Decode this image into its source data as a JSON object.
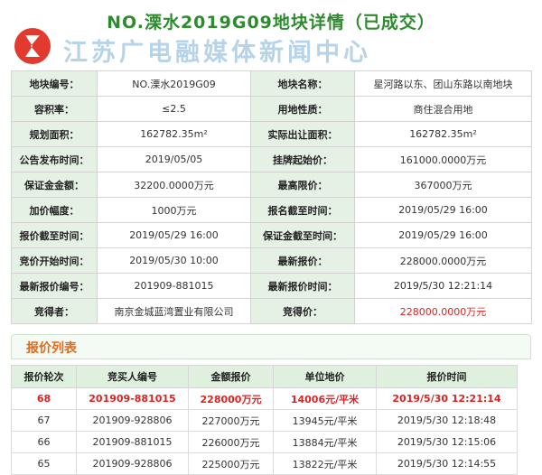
{
  "header": {
    "title": "NO.溧水2019G09地块详情（已成交）",
    "watermark": "江苏广电融媒体新闻中心"
  },
  "details": [
    [
      {
        "label": "地块编号：",
        "value": "NO.溧水2019G09"
      },
      {
        "label": "地块名称：",
        "value": "星河路以东、团山东路以南地块"
      }
    ],
    [
      {
        "label": "容积率：",
        "value": "≤2.5"
      },
      {
        "label": "用地性质：",
        "value": "商住混合用地"
      }
    ],
    [
      {
        "label": "规划面积：",
        "value": "162782.35m²"
      },
      {
        "label": "实际出让面积：",
        "value": "162782.35m²"
      }
    ],
    [
      {
        "label": "公告发布时间：",
        "value": "2019/05/05"
      },
      {
        "label": "挂牌起始价：",
        "value": "161000.0000万元"
      }
    ],
    [
      {
        "label": "保证金金额：",
        "value": "32200.0000万元"
      },
      {
        "label": "最高限价：",
        "value": "367000万元"
      }
    ],
    [
      {
        "label": "加价幅度：",
        "value": "1000万元"
      },
      {
        "label": "报名截至时间：",
        "value": "2019/05/29 16:00"
      }
    ],
    [
      {
        "label": "报价截至时间：",
        "value": "2019/05/29 16:00"
      },
      {
        "label": "保证金截至时间：",
        "value": "2019/05/29 16:00"
      }
    ],
    [
      {
        "label": "竞价开始时间：",
        "value": "2019/05/30 10:00"
      },
      {
        "label": "最新报价：",
        "value": "228000.0000万元"
      }
    ],
    [
      {
        "label": "最新报价编号：",
        "value": "201909-881015"
      },
      {
        "label": "最新报价时间：",
        "value": "2019/5/30 12:21:14"
      }
    ],
    [
      {
        "label": "竞得者：",
        "value": "南京金城蓝湾置业有限公司"
      },
      {
        "label": "竞得价：",
        "value": "228000.0000万元",
        "red": true
      }
    ]
  ],
  "quotes": {
    "title": "报价列表",
    "columns": [
      "报价轮次",
      "竞买人编号",
      "金额报价",
      "单位地价",
      "报价时间"
    ],
    "rows": [
      [
        "68",
        "201909-881015",
        "228000万元",
        "14006元/平米",
        "2019/5/30 12:21:14"
      ],
      [
        "67",
        "201909-928806",
        "227000万元",
        "13945元/平米",
        "2019/5/30 12:18:48"
      ],
      [
        "66",
        "201909-881015",
        "226000万元",
        "13884元/平米",
        "2019/5/30 12:15:06"
      ],
      [
        "65",
        "201909-928806",
        "225000万元",
        "13822元/平米",
        "2019/5/30 12:14:55"
      ]
    ]
  },
  "colors": {
    "title": "#2e8b2e",
    "label_bg": "#e6f1e6",
    "highlight": "#dd2222",
    "section_title": "#e26a1c"
  }
}
